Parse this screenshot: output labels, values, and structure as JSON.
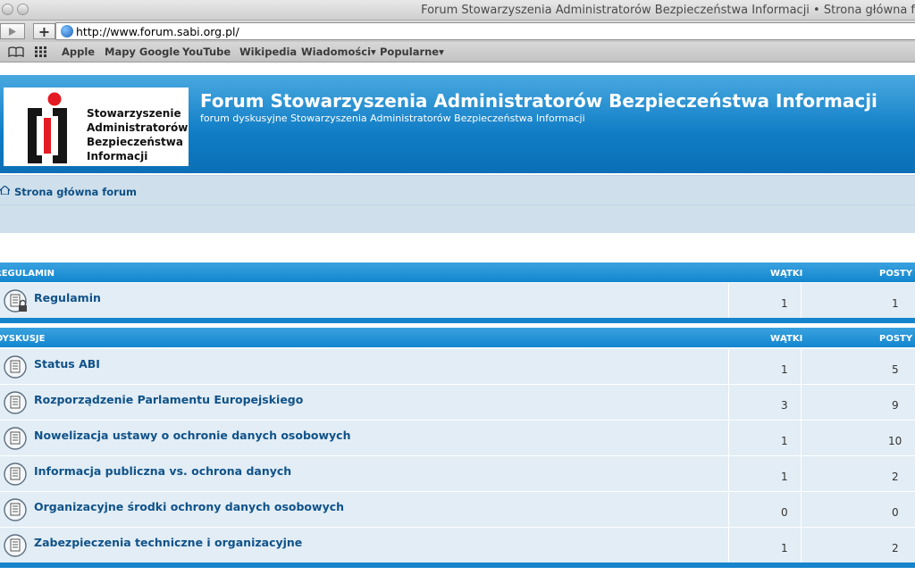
{
  "browser": {
    "window_title": "Forum Stowarzyszenia Administratorów Bezpieczeństwa Informacji • Strona główna f",
    "url": "http://www.forum.sabi.org.pl/",
    "bookmarks": [
      "Apple",
      "Mapy Google",
      "YouTube",
      "Wikipedia",
      "Wiadomości▾",
      "Popularne▾"
    ]
  },
  "site": {
    "logo_lines": [
      "Stowarzyszenie",
      "Administratorów",
      "Bezpieczeństwa",
      "Informacji"
    ],
    "title": "Forum Stowarzyszenia Administratorów Bezpieczeństwa Informacji",
    "description": "forum dyskusyjne Stowarzyszenia Administratorów Bezpieczeństwa Informacji",
    "home_link": "Strona główna forum"
  },
  "categories": [
    {
      "name": "REGULAMIN",
      "col_topics": "WĄTKI",
      "col_posts": "POSTY",
      "forums": [
        {
          "title": "Regulamin",
          "topics": "1",
          "posts": "1",
          "locked": true
        }
      ]
    },
    {
      "name": "DYSKUSJE",
      "col_topics": "WĄTKI",
      "col_posts": "POSTY",
      "forums": [
        {
          "title": "Status ABI",
          "topics": "1",
          "posts": "5"
        },
        {
          "title": "Rozporządzenie Parlamentu Europejskiego",
          "topics": "3",
          "posts": "9"
        },
        {
          "title": "Nowelizacja ustawy o ochronie danych osobowych",
          "topics": "1",
          "posts": "10"
        },
        {
          "title": "Informacja publiczna vs. ochrona danych",
          "topics": "1",
          "posts": "2"
        },
        {
          "title": "Organizacyjne środki ochrony danych osobowych",
          "topics": "0",
          "posts": "0"
        },
        {
          "title": "Zabezpieczenia techniczne i organizacyjne",
          "topics": "1",
          "posts": "2"
        }
      ]
    }
  ],
  "colors": {
    "header_blue": "#0f7cc5",
    "link": "#105289",
    "row_bg": "#e2edf5",
    "logo_red": "#e41b23"
  }
}
